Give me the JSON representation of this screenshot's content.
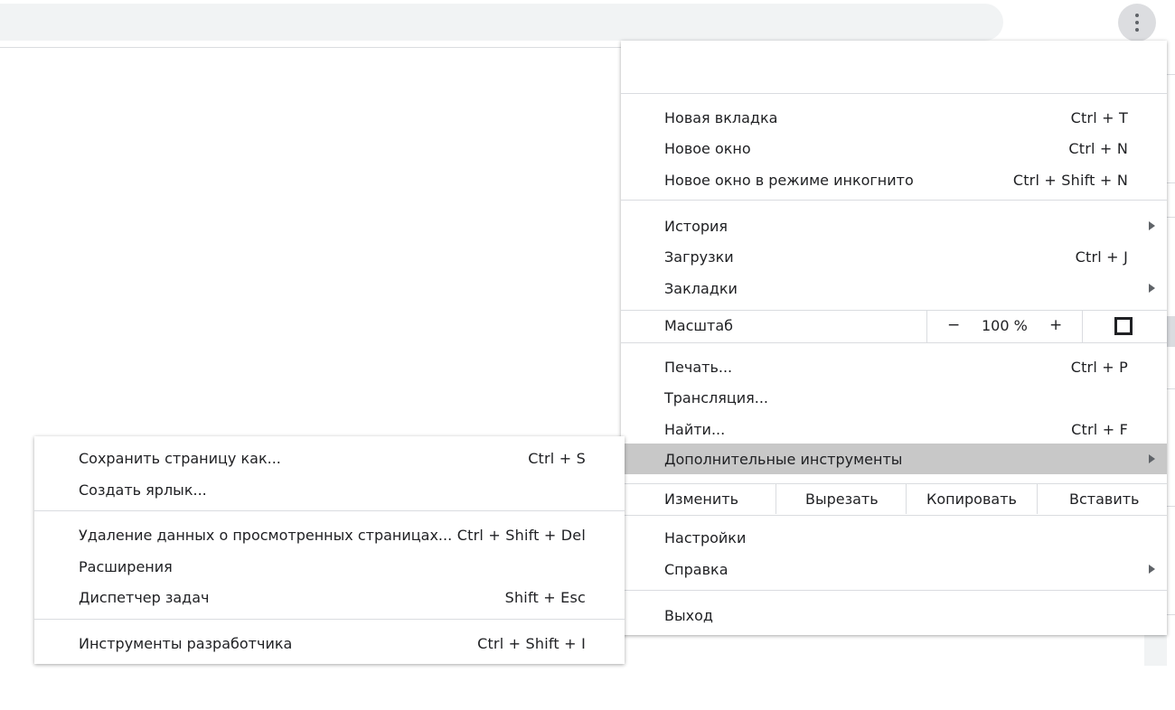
{
  "menu": {
    "group1": [
      {
        "label": "Новая вкладка",
        "shortcut": "Ctrl + T"
      },
      {
        "label": "Новое окно",
        "shortcut": "Ctrl + N"
      },
      {
        "label": "Новое окно в режиме инкогнито",
        "shortcut": "Ctrl + Shift + N"
      }
    ],
    "group2": [
      {
        "label": "История"
      },
      {
        "label": "Загрузки",
        "shortcut": "Ctrl + J"
      },
      {
        "label": "Закладки"
      }
    ],
    "zoom": {
      "label": "Масштаб",
      "minus": "−",
      "value": "100 %",
      "plus": "+"
    },
    "group3": [
      {
        "label": "Печать...",
        "shortcut": "Ctrl + P"
      },
      {
        "label": "Трансляция..."
      },
      {
        "label": "Найти...",
        "shortcut": "Ctrl + F"
      },
      {
        "label": "Дополнительные инструменты"
      }
    ],
    "edit": {
      "label": "Изменить",
      "cut": "Вырезать",
      "copy": "Копировать",
      "paste": "Вставить"
    },
    "group4": [
      {
        "label": "Настройки"
      },
      {
        "label": "Справка"
      }
    ],
    "exit": {
      "label": "Выход"
    }
  },
  "submenu": {
    "group1": [
      {
        "label": "Сохранить страницу как...",
        "shortcut": "Ctrl + S"
      },
      {
        "label": "Создать ярлык..."
      }
    ],
    "group2": [
      {
        "label": "Удаление данных о просмотренных страницах...",
        "shortcut": "Ctrl + Shift + Del"
      },
      {
        "label": "Расширения"
      },
      {
        "label": "Диспетчер задач",
        "shortcut": "Shift + Esc"
      }
    ],
    "group3": [
      {
        "label": "Инструменты разработчика",
        "shortcut": "Ctrl + Shift + I"
      }
    ]
  },
  "icons": {
    "menu": "vertical-dots-icon",
    "submenu_arrow": "triangle-right-icon",
    "fullscreen": "fullscreen-icon"
  },
  "colors": {
    "highlight": "#c8c8c8",
    "toolbar_pill": "#f1f3f4",
    "separator": "#dadce0",
    "text": "#202124"
  }
}
